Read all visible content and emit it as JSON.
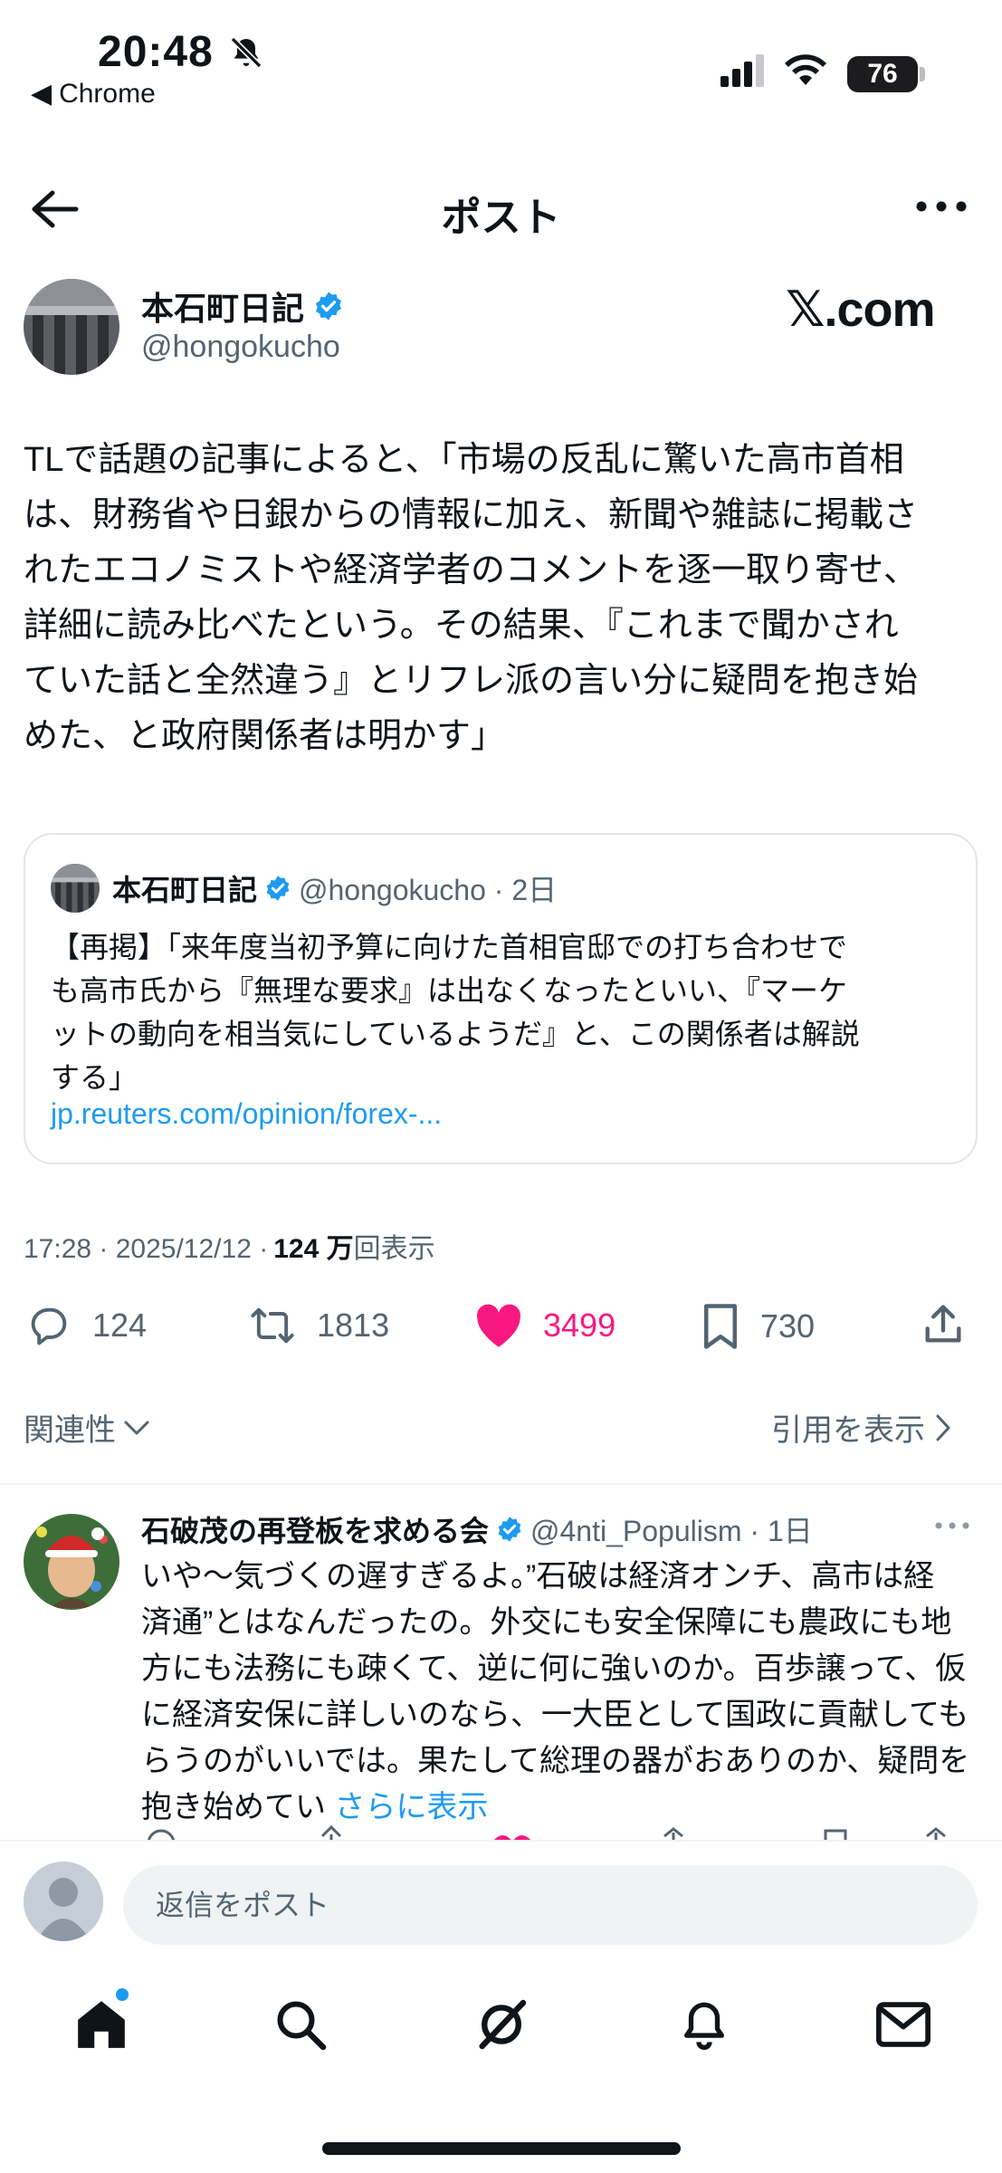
{
  "status_bar": {
    "time": "20:48",
    "back_to_app": "Chrome",
    "battery": "76"
  },
  "header": {
    "title": "ポスト"
  },
  "post": {
    "author": {
      "name": "本石町日記",
      "handle": "@hongokucho",
      "verified": true
    },
    "brand": "𝕏.com",
    "body": "TLで話題の記事によると、「市場の反乱に驚いた高市首相\nは、財務省や日銀からの情報に加え、新聞や雑誌に掲載さ\nれたエコノミストや経済学者のコメントを逐一取り寄せ、\n詳細に読み比べたという。その結果、『これまで聞かされ\nていた話と全然違う』とリフレ派の言い分に疑問を抱き始\nめた、と政府関係者は明かす」",
    "quote": {
      "name": "本石町日記",
      "handle_time": "@hongokucho · 2日",
      "body": "【再掲】「来年度当初予算に向けた首相官邸での打ち合わせで\nも高市氏から『無理な要求』は出なくなったといい、『マーケ\nットの動向を相当気にしているようだ』と、この関係者は解説\nする」",
      "link": "jp.reuters.com/opinion/forex-..."
    },
    "meta": {
      "timestamp": "17:28 · 2025/12/12 · ",
      "views_count": "124 万",
      "views_label": "回表示"
    },
    "actions": {
      "replies": "124",
      "reposts": "1813",
      "likes": "3499",
      "bookmarks": "730"
    }
  },
  "replies_section": {
    "sort_label": "関連性",
    "view_quotes": "引用を表示"
  },
  "reply": {
    "name": "石破茂の再登板を求める会",
    "handle_time": "@4nti_Populism · 1日",
    "verified": true,
    "body": "いや〜気づくの遅すぎるよ。”石破は経済オンチ、高市は経\n済通”とはなんだったの。外交にも安全保障にも農政にも地\n方にも法務にも疎くて、逆に何に強いのか。百歩譲って、仮\nに経済安保に詳しいのなら、一大臣として国政に貢献しても\nらうのがいいでは。果たして総理の器がおありのか、疑問を\n抱き始めてい ",
    "show_more": "さらに表示"
  },
  "composer": {
    "placeholder": "返信をポスト"
  },
  "colors": {
    "accent": "#1d9bf0",
    "like": "#f91880",
    "text_secondary": "#536471"
  },
  "icons": [
    "bell-off-icon",
    "signal-icon",
    "wifi-icon",
    "back-arrow-icon",
    "more-icon",
    "verified-badge-icon",
    "reply-icon",
    "repost-icon",
    "heart-icon",
    "bookmark-icon",
    "share-icon",
    "chevron-down-icon",
    "chevron-right-icon",
    "home-icon",
    "search-icon",
    "grok-icon",
    "bell-icon",
    "mail-icon"
  ]
}
